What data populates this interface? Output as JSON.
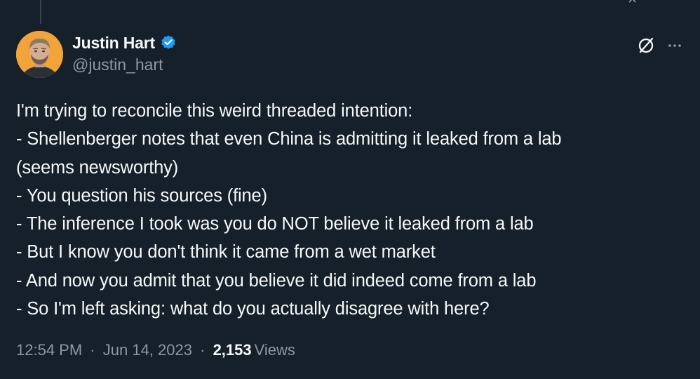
{
  "tweet": {
    "author": {
      "display_name": "Justin Hart",
      "handle": "@justin_hart",
      "verified": true
    },
    "text_lines": [
      "I'm trying to reconcile this weird threaded intention:",
      "- Shellenberger notes that even China is admitting it leaked from a lab",
      "(seems newsworthy)",
      "- You question his sources (fine)",
      "- The inference I took was you do NOT believe it leaked from a lab",
      "- But I know you don't think it came from a wet market",
      "- And now you admit that you believe it did indeed come from a lab",
      "- So I'm left asking: what do you actually disagree with here?"
    ],
    "meta": {
      "time": "12:54 PM",
      "separator": "·",
      "date": "Jun 14, 2023",
      "views_count": "2,153",
      "views_label": "Views"
    }
  },
  "icons": {
    "verified": "verified-badge-icon",
    "grok": "grok-icon",
    "more": "more-icon"
  },
  "colors": {
    "background": "#15202b",
    "text_primary": "#f7f9f9",
    "text_secondary": "#8b98a5",
    "verified_blue": "#1d9bf0",
    "avatar_bg": "#f2a33a"
  }
}
